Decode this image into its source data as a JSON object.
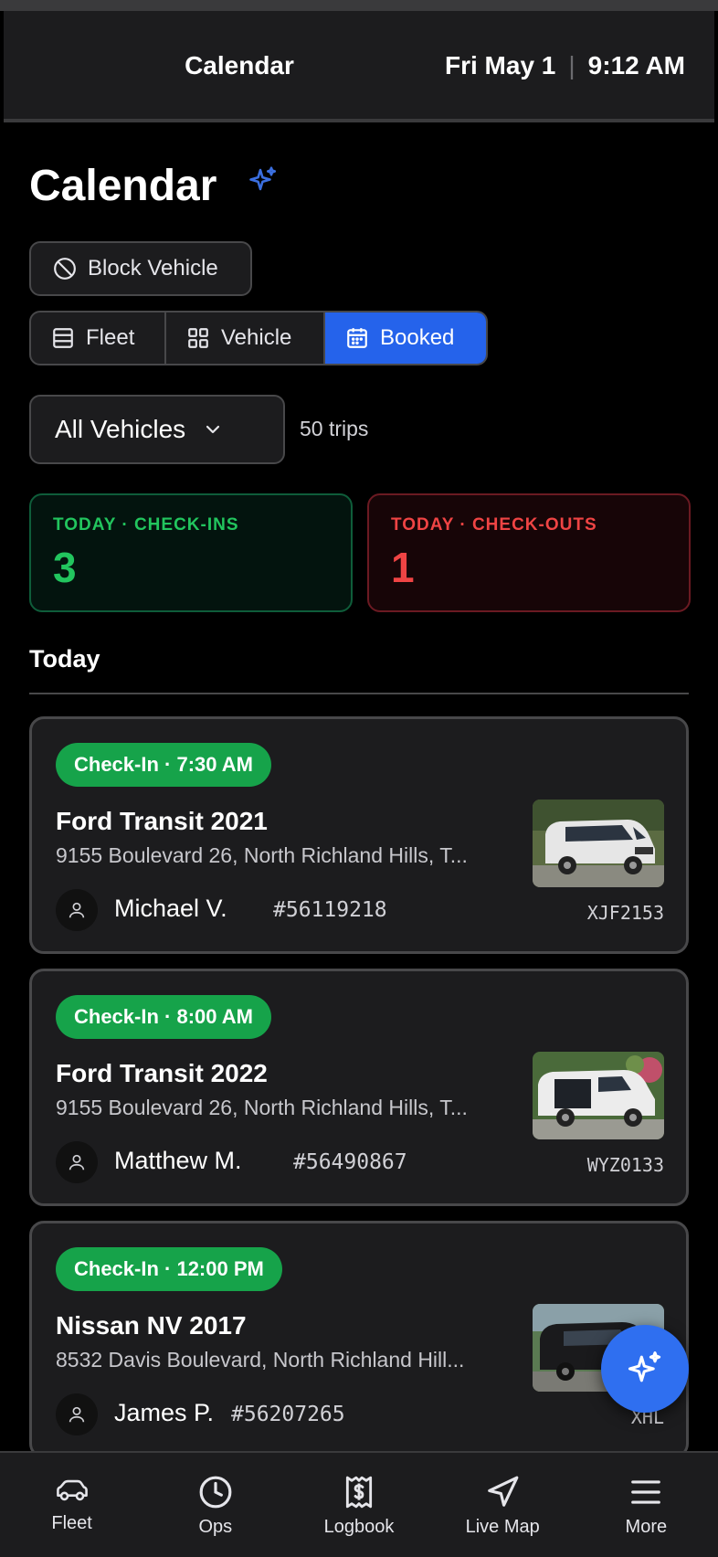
{
  "status_bar": {
    "title": "Calendar",
    "date": "Fri May 1",
    "separator": "|",
    "time": "9:12 AM"
  },
  "header": {
    "title": "Calendar",
    "ai_icon": "sparkle-icon"
  },
  "block_vehicle_label": "Block Vehicle",
  "view_toggle": {
    "options": [
      {
        "label": "Fleet",
        "icon": "list-icon",
        "active": false
      },
      {
        "label": "Vehicle",
        "icon": "grid-icon",
        "active": false
      },
      {
        "label": "Booked",
        "icon": "calendar-icon",
        "active": true
      }
    ]
  },
  "filter": {
    "selected": "All Vehicles",
    "trip_count": "50 trips"
  },
  "stats": {
    "checkins": {
      "label": "TODAY · CHECK-INS",
      "value": "3",
      "color": "#22c55e"
    },
    "checkouts": {
      "label": "TODAY · CHECK-OUTS",
      "value": "1",
      "color": "#ef4444"
    }
  },
  "section_title": "Today",
  "trips": [
    {
      "badge": "Check-In · 7:30 AM",
      "vehicle": "Ford Transit 2021",
      "address": "9155 Boulevard 26, North Richland Hills, T...",
      "driver": "Michael V.",
      "booking": "#56119218",
      "plate": "XJF2153"
    },
    {
      "badge": "Check-In · 8:00 AM",
      "vehicle": "Ford Transit 2022",
      "address": "9155 Boulevard 26, North Richland Hills, T...",
      "driver": "Matthew M.",
      "booking": "#56490867",
      "plate": "WYZ0133"
    },
    {
      "badge": "Check-In · 12:00 PM",
      "vehicle": "Nissan NV 2017",
      "address": "8532 Davis Boulevard, North Richland Hill...",
      "driver": "James P.",
      "booking": "#56207265",
      "plate": "XHL"
    }
  ],
  "colors": {
    "accent": "#2563eb",
    "checkin_badge": "#16a34a"
  },
  "tabbar": {
    "items": [
      {
        "label": "Fleet",
        "icon": "car-icon"
      },
      {
        "label": "Ops",
        "icon": "clock-icon"
      },
      {
        "label": "Logbook",
        "icon": "receipt-icon"
      },
      {
        "label": "Live Map",
        "icon": "navigation-icon"
      },
      {
        "label": "More",
        "icon": "menu-icon"
      }
    ]
  }
}
